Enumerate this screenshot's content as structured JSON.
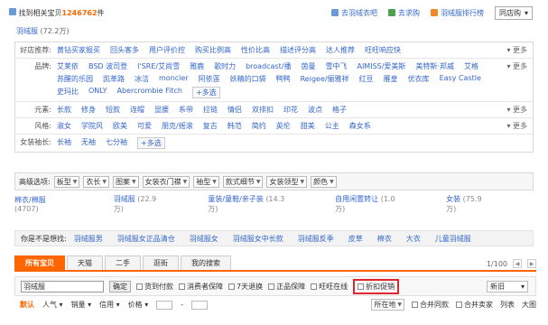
{
  "top": {
    "found_prefix": "找到相关宝贝",
    "found_count": "1246762",
    "found_suffix": "件",
    "links": [
      "去羽绒衣吧",
      "去求购",
      "羽绒服排行榜"
    ],
    "scope_select": "同店购"
  },
  "breadcrumb": {
    "keyword": "羽绒服",
    "count": "(72.2万)"
  },
  "rows": [
    {
      "label": "好店推荐:",
      "values": [
        "黄钻买家报买",
        "回头客多",
        "用户评价控",
        "购买比例高",
        "性价比高",
        "描述评分高",
        "达人推荐",
        "旺旺响应快"
      ],
      "more": "更多"
    },
    {
      "label": "品牌:",
      "values": [
        "艾莱依",
        "BSD 波司登",
        "I'SRE/艾尚雪",
        "雅鹿",
        "歌时力",
        "broadcast/播",
        "茵曼",
        "雪中飞",
        "AIMISS/爱美斯",
        "美特斯·邦威",
        "艾格",
        "苏醒的乐园",
        "凯革路",
        "冰洁",
        "moncler",
        "阿依莲",
        "妖精的口袋",
        "鸭鸭",
        "Reigee/俪雅祥",
        "红豆",
        "雁皇",
        "优衣库",
        "Easy Castle",
        "史玛比",
        "ONLY",
        "Abercrombie Fitch"
      ],
      "multi": "+多选",
      "more": "更多"
    },
    {
      "label": "元素:",
      "values": [
        "长款",
        "修身",
        "短款",
        "连帽",
        "显腰",
        "系带",
        "拉链",
        "情侣",
        "双排扣",
        "印花",
        "波点",
        "格子"
      ],
      "more": "更多"
    },
    {
      "label": "风格:",
      "values": [
        "淑女",
        "学院风",
        "欧美",
        "可爱",
        "朋克/摇滚",
        "复古",
        "韩范",
        "简约",
        "英伦",
        "甜美",
        "公主",
        "森女系"
      ],
      "more": "更多"
    },
    {
      "label": "女装袖长:",
      "values": [
        "长袖",
        "无袖",
        "七分袖"
      ],
      "multi": "+多选",
      "more": ""
    }
  ],
  "advanced": {
    "label": "高级选项:",
    "dropdowns": [
      "板型",
      "衣长",
      "图案",
      "女装衣门襟",
      "袖型",
      "款式细节",
      "女装领型",
      "颜色"
    ]
  },
  "categories": [
    {
      "name": "棉衣/棉服",
      "count": "(4707)"
    },
    {
      "name": "羽绒服",
      "count": "(22.9万)"
    },
    {
      "name": "童装/童鞋/亲子装",
      "count": "(14.3万)"
    },
    {
      "name": "自用闲置转让",
      "count": "(1.0万)"
    },
    {
      "name": "女装",
      "count": "(75.9万)"
    }
  ],
  "suggest": {
    "label": "你是不是想找:",
    "items": [
      "羽绒服男",
      "羽绒服女正品清仓",
      "羽绒服女",
      "羽绒服女中长款",
      "羽绒服反季",
      "皮草",
      "棉衣",
      "大衣",
      "儿童羽绒服"
    ]
  },
  "tabs": [
    "所有宝贝",
    "天猫",
    "二手",
    "逛街",
    "我的搜索"
  ],
  "pager": "1/100",
  "filter": {
    "keyword": "羽绒服",
    "ok": "确定",
    "checks": [
      "货到付款",
      "消费者保障",
      "7天退换",
      "正品保障",
      "旺旺在线",
      "折扣促销"
    ],
    "sort_select": "新旧"
  },
  "sortbar": {
    "items": [
      "默认",
      "人气",
      "销量",
      "信用",
      "价格"
    ],
    "location": "所在地",
    "merge": [
      "合并同款",
      "合并卖家"
    ],
    "view": [
      "列表",
      "大图"
    ]
  }
}
